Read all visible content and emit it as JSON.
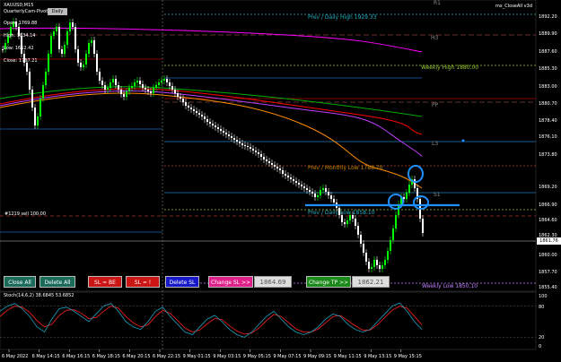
{
  "header": {
    "symbol": "XAUUSD,M15",
    "indicator": "QuarterlyCam-Pivots",
    "info_badge": "Daily",
    "ea_name": "mx_CloseAll v3d"
  },
  "info_panel": {
    "open": "Open: 1769.88",
    "high": "High: 1834.14",
    "low": "Low: 1652.42",
    "close": "Close: 1767.21"
  },
  "levels": {
    "prev_daily_high": "Prev / Daily High 1929.33",
    "h3": "H3",
    "weekly_high": "Weekly High 1880.00",
    "pp": "PP",
    "l3": "L3",
    "prev_monthly_low": "Prev / Monthly Low 1788.70",
    "s1": "S1",
    "prev_daily_low": "Prev / Daily Low 1858.10",
    "weekly_low": "Weekly Low 1850.10",
    "r1": "R1",
    "sell_line": "#1219 sell 100.00"
  },
  "price_axis": [
    "1892.20",
    "1889.90",
    "1887.60",
    "1885.30",
    "1883.00",
    "1880.70",
    "1878.40",
    "1876.10",
    "1873.80",
    "1869.20",
    "1866.90",
    "1864.60",
    "1862.30",
    "1860.00",
    "1857.70",
    "1855.40"
  ],
  "current_price": "1861.76",
  "buttons": {
    "close_all": "Close All",
    "delete_all": "Delete All",
    "sl_be": "SL = BE",
    "sl_plus": "SL = !",
    "delete_sl": "Delete SL",
    "change_sl": "Change SL >>",
    "sl_value": "1864.69",
    "change_tp": "Change TP >>",
    "tp_value": "1862.21"
  },
  "stoch": {
    "label": "Stoch(14,6,2) 38.6845 53.6852",
    "axis": [
      "100",
      "80",
      "20",
      "0"
    ]
  },
  "time_axis": [
    "6 May 2022",
    "6 May 14:15",
    "6 May 16:15",
    "6 May 18:15",
    "6 May 20:15",
    "6 May 22:15",
    "9 May 01:15",
    "9 May 03:15",
    "9 May 05:15",
    "9 May 07:15",
    "9 May 09:15",
    "9 May 11:15",
    "9 May 13:15",
    "9 May 15:15"
  ],
  "colors": {
    "background": "#000000",
    "bull_candle": "#00ff00",
    "bear_candle": "#ffffff",
    "ma_fast": "#ff8c00",
    "ma_mid": "#ff0000",
    "ma_slow": "#00b000",
    "ma_violet": "#c040ff",
    "ma_magenta": "#ff00ff",
    "stoch_main": "#20a0c0",
    "stoch_signal": "#ff2020",
    "highlight": "#1e90ff"
  }
}
